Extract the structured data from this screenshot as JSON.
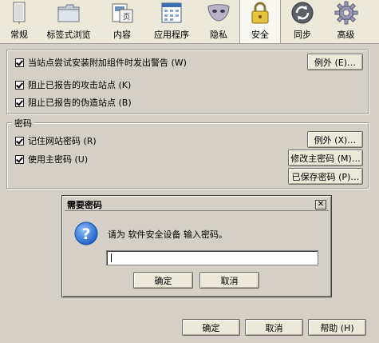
{
  "tabs": [
    {
      "label": "常规",
      "icon": "general-icon"
    },
    {
      "label": "标签式浏览",
      "icon": "folder-tabs-icon"
    },
    {
      "label": "内容",
      "icon": "content-icon"
    },
    {
      "label": "应用程序",
      "icon": "applications-icon"
    },
    {
      "label": "隐私",
      "icon": "privacy-mask-icon"
    },
    {
      "label": "安全",
      "icon": "lock-icon"
    },
    {
      "label": "同步",
      "icon": "sync-icon"
    },
    {
      "label": "高级",
      "icon": "gear-icon"
    }
  ],
  "active_tab": "安全",
  "general": {
    "warn_addon_label": "当站点尝试安装附加组件时发出警告 (W)",
    "warn_addon_checked": true,
    "exceptions1": "例外 (E)…",
    "block_attack_label": "阻止已报告的攻击站点 (K)",
    "block_attack_checked": true,
    "block_forgery_label": "阻止已报告的伪造站点 (B)",
    "block_forgery_checked": true
  },
  "passwords": {
    "legend": "密码",
    "remember_label": "记住网站密码 (R)",
    "remember_checked": true,
    "exceptions2": "例外 (X)…",
    "master_label": "使用主密码 (U)",
    "master_checked": true,
    "change_master": "修改主密码 (M)…",
    "saved_passwords": "已保存密码 (P)…"
  },
  "dialog": {
    "title": "需要密码",
    "message": "请为 软件安全设备 输入密码。",
    "input_value": "",
    "ok": "确定",
    "cancel": "取消",
    "close_glyph": "✕"
  },
  "footer": {
    "ok": "确定",
    "cancel": "取消",
    "help": "帮助 (H)"
  }
}
